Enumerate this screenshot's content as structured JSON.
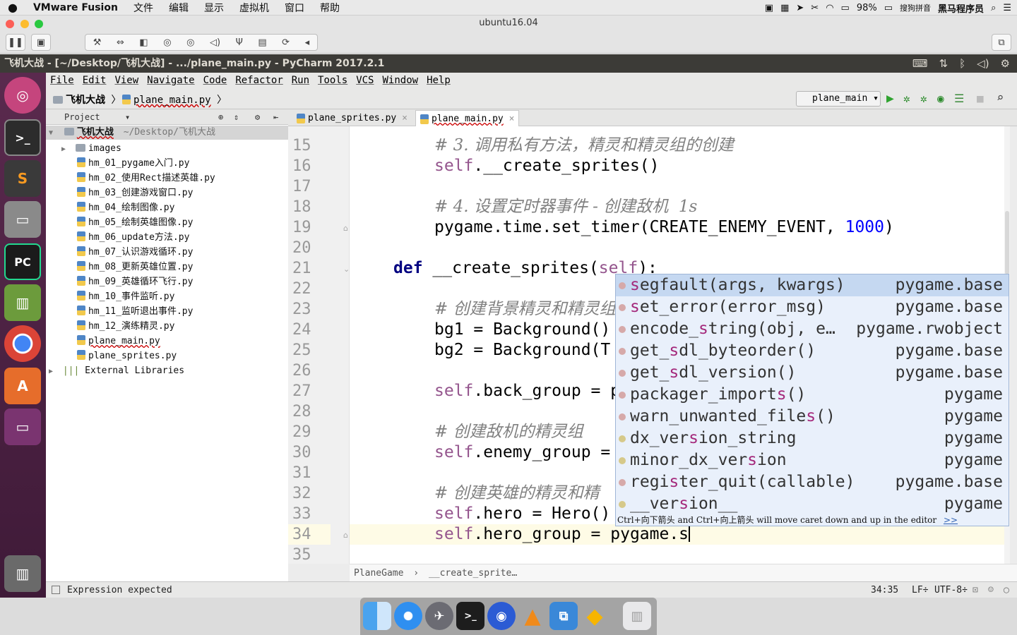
{
  "mac_menubar": {
    "apple": "",
    "app_name": "VMware Fusion",
    "items": [
      "文件",
      "编辑",
      "显示",
      "虚拟机",
      "窗口",
      "帮助"
    ],
    "battery": "98%",
    "ime": "搜狗拼音",
    "user": "黑马程序员"
  },
  "vm_window": {
    "title": "ubuntu16.04"
  },
  "ubuntu_bar": {
    "title": "飞机大战 - [~/Desktop/飞机大战] - .../plane_main.py - PyCharm 2017.2.1"
  },
  "pycharm": {
    "menu": [
      "File",
      "Edit",
      "View",
      "Navigate",
      "Code",
      "Refactor",
      "Run",
      "Tools",
      "VCS",
      "Window",
      "Help"
    ],
    "nav_project": "飞机大战",
    "nav_file": "plane_main.py",
    "run_config": "plane_main",
    "project_header": "Project",
    "tree": [
      {
        "label": "飞机大战",
        "path": "~/Desktop/飞机大战",
        "type": "root"
      },
      {
        "label": "images",
        "type": "folder"
      },
      {
        "label": "hm_01_pygame入门.py",
        "type": "file"
      },
      {
        "label": "hm_02_使用Rect描述英雄.py",
        "type": "file"
      },
      {
        "label": "hm_03_创建游戏窗口.py",
        "type": "file"
      },
      {
        "label": "hm_04_绘制图像.py",
        "type": "file"
      },
      {
        "label": "hm_05_绘制英雄图像.py",
        "type": "file"
      },
      {
        "label": "hm_06_update方法.py",
        "type": "file"
      },
      {
        "label": "hm_07_认识游戏循环.py",
        "type": "file"
      },
      {
        "label": "hm_08_更新英雄位置.py",
        "type": "file"
      },
      {
        "label": "hm_09_英雄循环飞行.py",
        "type": "file"
      },
      {
        "label": "hm_10_事件监听.py",
        "type": "file"
      },
      {
        "label": "hm_11_监听退出事件.py",
        "type": "file"
      },
      {
        "label": "hm_12_演练精灵.py",
        "type": "file"
      },
      {
        "label": "plane_main.py",
        "type": "file"
      },
      {
        "label": "plane_sprites.py",
        "type": "file"
      },
      {
        "label": "External Libraries",
        "type": "lib"
      }
    ],
    "tabs": [
      {
        "label": "plane_sprites.py",
        "active": false
      },
      {
        "label": "plane_main.py",
        "active": true
      }
    ],
    "line_numbers": [
      "15",
      "16",
      "17",
      "18",
      "19",
      "20",
      "21",
      "22",
      "23",
      "24",
      "25",
      "26",
      "27",
      "28",
      "29",
      "30",
      "31",
      "32",
      "33",
      "34",
      "35"
    ],
    "code": {
      "l15": "# 3. 调用私有方法，精灵和精灵组的创建",
      "l16a": "self",
      "l16b": ".__create_sprites()",
      "l18": "# 4. 设置定时器事件 - 创建敌机  1s",
      "l19a": "pygame.time.set_timer(CREATE_ENEMY_EVENT, ",
      "l19n": "1000",
      "l19b": ")",
      "l21k": "def",
      "l21a": " __create_sprites(",
      "l21s": "self",
      "l21b": "):",
      "l23": "# 创建背景精灵和精灵组",
      "l24": "bg1 = Background()",
      "l25": "bg2 = Background(T",
      "l27a": "self",
      "l27b": ".back_group = p",
      "l29": "# 创建敌机的精灵组",
      "l30a": "self",
      "l30b": ".enemy_group = ",
      "l32": "# 创建英雄的精灵和精",
      "l33a": "self",
      "l33b": ".hero = Hero()",
      "l34a": "self",
      "l34b": ".hero_group = pygame.s"
    },
    "completion": [
      {
        "pre": "",
        "hl": "s",
        "post": "egfault(args, kwargs)",
        "module": "pygame.base"
      },
      {
        "pre": "",
        "hl": "s",
        "post": "et_error(error_msg)",
        "module": "pygame.base"
      },
      {
        "pre": "encode_",
        "hl": "s",
        "post": "tring(obj, e…",
        "module": "pygame.rwobject"
      },
      {
        "pre": "get_",
        "hl": "s",
        "post": "dl_byteorder()",
        "module": "pygame.base"
      },
      {
        "pre": "get_",
        "hl": "s",
        "post": "dl_version()",
        "module": "pygame.base"
      },
      {
        "pre": "packager_import",
        "hl": "s",
        "post": "()",
        "module": "pygame"
      },
      {
        "pre": "warn_unwanted_file",
        "hl": "s",
        "post": "()",
        "module": "pygame"
      },
      {
        "pre": "dx_ver",
        "hl": "s",
        "post": "ion_string",
        "module": "pygame"
      },
      {
        "pre": "minor_dx_ver",
        "hl": "s",
        "post": "ion",
        "module": "pygame"
      },
      {
        "pre": "regi",
        "hl": "s",
        "post": "ter_quit(callable)",
        "module": "pygame.base"
      },
      {
        "pre": "__ver",
        "hl": "s",
        "post": "ion__",
        "module": "pygame"
      }
    ],
    "completion_hint": "Ctrl+向下箭头 and Ctrl+向上箭头 will move caret down and up in the editor",
    "completion_hint_link": ">>",
    "editor_breadcrumb": [
      "PlaneGame",
      "__create_sprite…"
    ],
    "status_message": "Expression expected",
    "status_position": "34:35",
    "status_lf": "LF÷",
    "status_encoding": "UTF-8÷"
  },
  "colors": {
    "launcher": "#4a2040",
    "ubuntu_bar": "#3c3b37",
    "popup": "#e9f0fb",
    "keyword": "#000080",
    "self": "#94558d",
    "number": "#0000ff"
  }
}
